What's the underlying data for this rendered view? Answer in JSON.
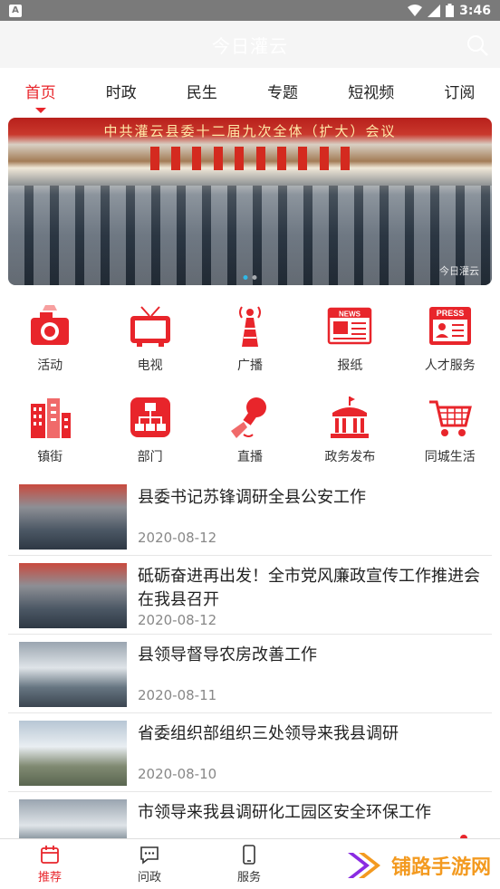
{
  "status_bar": {
    "time": "3:46",
    "left_icon": "A"
  },
  "header": {
    "title": "今日灌云"
  },
  "tabs": [
    {
      "label": "首页",
      "active": true
    },
    {
      "label": "时政"
    },
    {
      "label": "民生"
    },
    {
      "label": "专题"
    },
    {
      "label": "短视频"
    },
    {
      "label": "订阅"
    }
  ],
  "banner": {
    "caption": "中共灌云县委十二届九次全体（扩大）会议",
    "watermark": "今日灌云"
  },
  "grid": [
    {
      "label": "活动",
      "icon": "camera-icon"
    },
    {
      "label": "电视",
      "icon": "tv-icon"
    },
    {
      "label": "广播",
      "icon": "radio-tower-icon"
    },
    {
      "label": "报纸",
      "icon": "newspaper-icon"
    },
    {
      "label": "人才服务",
      "icon": "press-card-icon"
    },
    {
      "label": "镇街",
      "icon": "buildings-icon"
    },
    {
      "label": "部门",
      "icon": "org-chart-icon"
    },
    {
      "label": "直播",
      "icon": "live-mic-icon"
    },
    {
      "label": "政务发布",
      "icon": "government-building-icon"
    },
    {
      "label": "同城生活",
      "icon": "shopping-cart-icon"
    }
  ],
  "icon_text": {
    "news": "NEWS",
    "press": "PRESS"
  },
  "news": [
    {
      "title": "县委书记苏锋调研全县公安工作",
      "date": "2020-08-12"
    },
    {
      "title": "砥砺奋进再出发！全市党风廉政宣传工作推进会在我县召开",
      "date": "2020-08-12"
    },
    {
      "title": "县领导督导农房改善工作",
      "date": "2020-08-11"
    },
    {
      "title": "省委组织部组织三处领导来我县调研",
      "date": "2020-08-10"
    },
    {
      "title": "市领导来我县调研化工园区安全环保工作",
      "date": ""
    }
  ],
  "bottom_nav": [
    {
      "label": "推荐",
      "icon": "calendar-icon",
      "active": true
    },
    {
      "label": "问政",
      "icon": "chat-bubble-icon"
    },
    {
      "label": "服务",
      "icon": "phone-icon"
    }
  ],
  "watermark": {
    "text": "铺路手游网"
  },
  "colors": {
    "accent": "#e8252b",
    "watermark": "#f39a20"
  }
}
